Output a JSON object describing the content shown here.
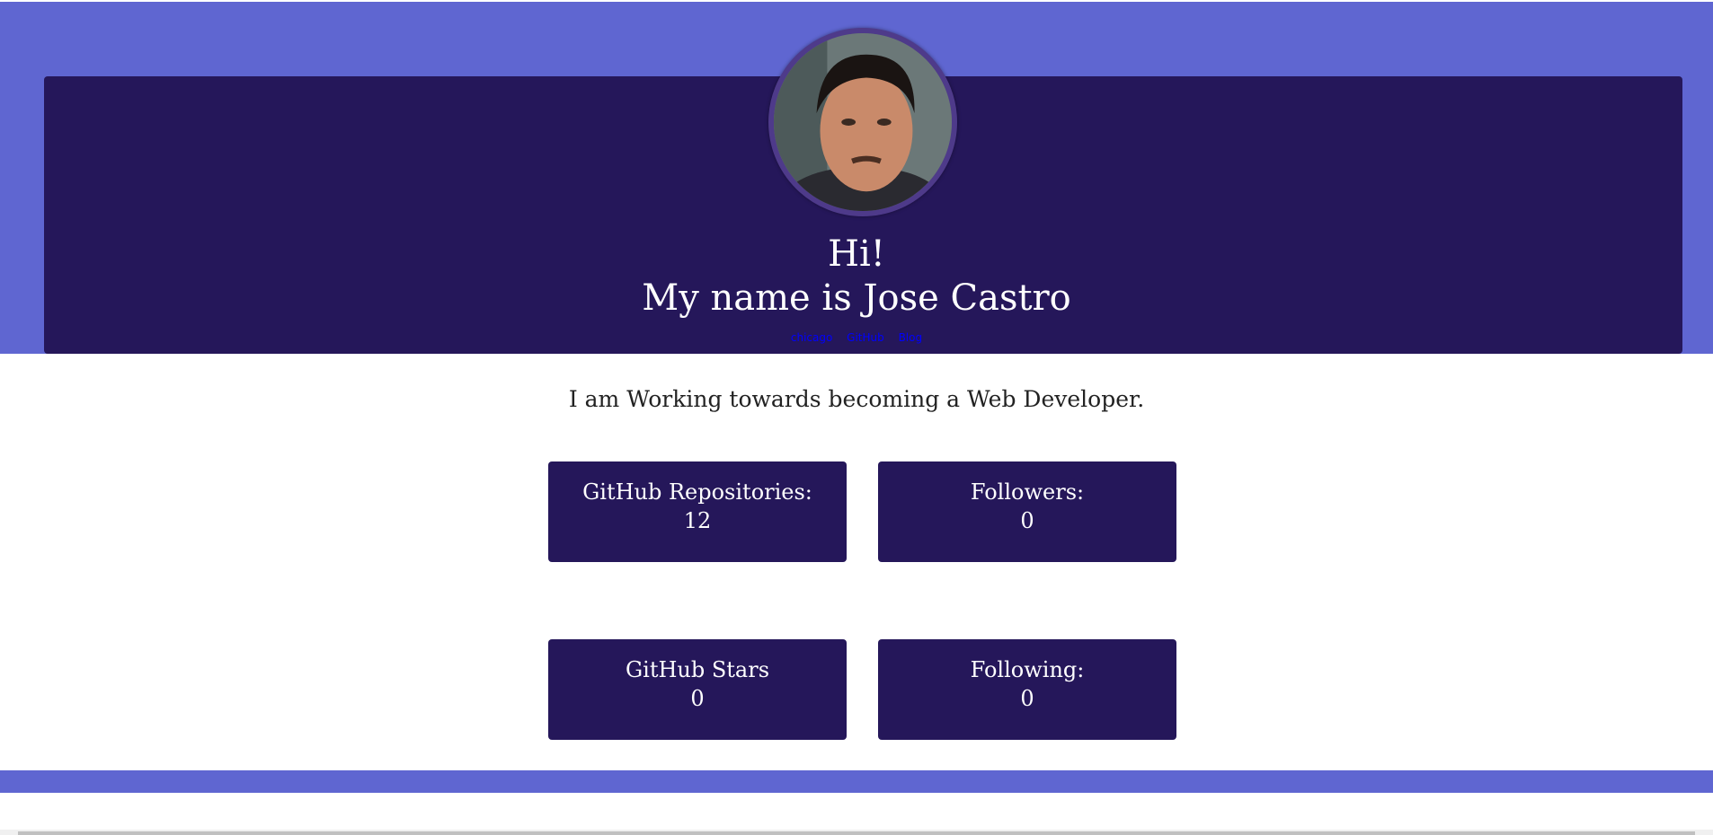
{
  "header": {
    "greeting": "Hi!",
    "name_line": "My name is Jose Castro",
    "links": [
      "chicago",
      "GitHub",
      "Blog"
    ]
  },
  "tagline": "I am Working towards becoming a Web Developer.",
  "stats": [
    {
      "label": "GitHub Repositories:",
      "value": "12"
    },
    {
      "label": "Followers:",
      "value": "0"
    },
    {
      "label": "GitHub Stars",
      "value": "0"
    },
    {
      "label": "Following:",
      "value": "0"
    }
  ],
  "colors": {
    "band": "#5f66d1",
    "panel": "#25175a",
    "link": "#0000ff"
  }
}
